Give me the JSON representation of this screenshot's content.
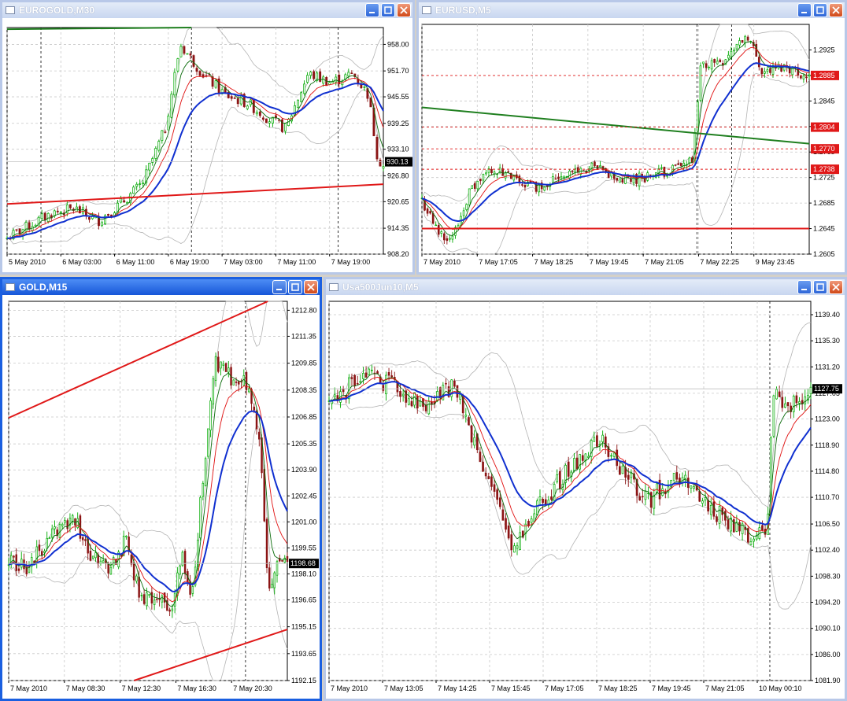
{
  "colors": {
    "grid": "#c8c8c8",
    "bull": "#00aa00",
    "bear": "#8b1414",
    "candle_body_bull": "#ffffff",
    "ma_fast": "#0b6b0b",
    "ma_mid": "#e01010",
    "ma_slow": "#1030d0",
    "bands": "#b4b4b4",
    "trend_green": "#1f7f1f",
    "trend_red": "#e01818",
    "level_red": "#e01818",
    "price_tag_bg": "#000000"
  },
  "windows": [
    {
      "id": "eurogold",
      "title": "EUROGOLD,M30",
      "active": false,
      "icon": "chart-window-icon",
      "chart_data": {
        "type": "candlestick",
        "ylim": [
          908.2,
          962.0
        ],
        "y_ticks": [
          "958.00",
          "951.70",
          "945.55",
          "939.25",
          "933.10",
          "926.80",
          "920.65",
          "914.35",
          "908.20"
        ],
        "x_labels": [
          "5 May 2010",
          "6 May 03:00",
          "6 May 11:00",
          "6 May 19:00",
          "7 May 03:00",
          "7 May 11:00",
          "7 May 19:00"
        ],
        "price_tag": "930.13",
        "price_value": 930.13,
        "anchors": [
          [
            0,
            912
          ],
          [
            0.06,
            915
          ],
          [
            0.12,
            918
          ],
          [
            0.18,
            919
          ],
          [
            0.24,
            916
          ],
          [
            0.3,
            920
          ],
          [
            0.36,
            925
          ],
          [
            0.42,
            938
          ],
          [
            0.46,
            958
          ],
          [
            0.52,
            951
          ],
          [
            0.58,
            946
          ],
          [
            0.64,
            944
          ],
          [
            0.7,
            940
          ],
          [
            0.74,
            938
          ],
          [
            0.8,
            951
          ],
          [
            0.86,
            949
          ],
          [
            0.92,
            951
          ],
          [
            0.96,
            946
          ],
          [
            0.985,
            931
          ],
          [
            1,
            929
          ]
        ],
        "gaps": [
          0.97
        ]
      }
    },
    {
      "id": "eurusd",
      "title": "EURUSD,M5",
      "active": false,
      "icon": "chart-window-icon",
      "chart_data": {
        "type": "candlestick",
        "ylim": [
          1.2605,
          1.2965
        ],
        "y_ticks": [
          "1.2925",
          "1.2885",
          "1.2845",
          "1.2805",
          "1.2765",
          "1.2725",
          "1.2685",
          "1.2645",
          "1.2605"
        ],
        "x_labels": [
          "7 May 2010",
          "7 May 17:05",
          "7 May 18:25",
          "7 May 19:45",
          "7 May 21:05",
          "7 May 22:25",
          "9 May 23:45"
        ],
        "levels": [
          {
            "label": "1.2885",
            "value": 1.2885
          },
          {
            "label": "1.2804",
            "value": 1.2804
          },
          {
            "label": "1.2770",
            "value": 1.277
          },
          {
            "label": "1.2738",
            "value": 1.2738
          }
        ],
        "anchors": [
          [
            0,
            1.269
          ],
          [
            0.04,
            1.264
          ],
          [
            0.08,
            1.263
          ],
          [
            0.12,
            1.27
          ],
          [
            0.18,
            1.274
          ],
          [
            0.24,
            1.272
          ],
          [
            0.3,
            1.271
          ],
          [
            0.36,
            1.273
          ],
          [
            0.44,
            1.274
          ],
          [
            0.52,
            1.272
          ],
          [
            0.6,
            1.273
          ],
          [
            0.66,
            1.274
          ],
          [
            0.7,
            1.275
          ],
          [
            0.72,
            1.29
          ],
          [
            0.78,
            1.291
          ],
          [
            0.84,
            1.295
          ],
          [
            0.88,
            1.289
          ],
          [
            0.94,
            1.29
          ],
          [
            1,
            1.288
          ]
        ],
        "gaps": [
          0.71
        ]
      }
    },
    {
      "id": "gold",
      "title": "GOLD,M15",
      "active": true,
      "icon": "chart-window-icon",
      "chart_data": {
        "type": "candlestick",
        "ylim": [
          1192.15,
          1213.3
        ],
        "y_ticks": [
          "1212.80",
          "1211.35",
          "1209.85",
          "1208.35",
          "1206.85",
          "1205.35",
          "1203.90",
          "1202.45",
          "1201.00",
          "1199.55",
          "1198.10",
          "1196.65",
          "1195.15",
          "1193.65",
          "1192.15"
        ],
        "x_labels": [
          "7 May 2010",
          "7 May 08:30",
          "7 May 12:30",
          "7 May 16:30",
          "7 May 20:30"
        ],
        "price_tag": "1198.68",
        "price_value": 1198.68,
        "anchors": [
          [
            0,
            1199
          ],
          [
            0.06,
            1198.5
          ],
          [
            0.12,
            1199.5
          ],
          [
            0.18,
            1200.5
          ],
          [
            0.24,
            1201
          ],
          [
            0.3,
            1199
          ],
          [
            0.36,
            1198.5
          ],
          [
            0.42,
            1200
          ],
          [
            0.48,
            1196.5
          ],
          [
            0.52,
            1197
          ],
          [
            0.58,
            1196
          ],
          [
            0.62,
            1199
          ],
          [
            0.66,
            1197
          ],
          [
            0.7,
            1204
          ],
          [
            0.74,
            1210
          ],
          [
            0.8,
            1209
          ],
          [
            0.86,
            1208.5
          ],
          [
            0.9,
            1206
          ],
          [
            0.93,
            1197
          ],
          [
            0.97,
            1199
          ],
          [
            1,
            1198.7
          ]
        ],
        "gaps": []
      }
    },
    {
      "id": "usa500",
      "title": "Usa500Jun10,M5",
      "active": false,
      "icon": "chart-window-icon",
      "chart_data": {
        "type": "candlestick",
        "ylim": [
          1081.9,
          1141.5
        ],
        "y_ticks": [
          "1139.40",
          "1135.30",
          "1131.20",
          "1127.05",
          "1123.00",
          "1118.90",
          "1114.80",
          "1110.70",
          "1106.50",
          "1102.40",
          "1098.30",
          "1094.20",
          "1090.10",
          "1086.00",
          "1081.90"
        ],
        "x_labels": [
          "7 May 2010",
          "7 May 13:05",
          "7 May 14:25",
          "7 May 15:45",
          "7 May 17:05",
          "7 May 18:25",
          "7 May 19:45",
          "7 May 21:05",
          "10 May 00:10"
        ],
        "price_tag": "1127.75",
        "price_value": 1127.75,
        "anchors": [
          [
            0,
            1126
          ],
          [
            0.08,
            1130
          ],
          [
            0.14,
            1128
          ],
          [
            0.2,
            1125
          ],
          [
            0.26,
            1128
          ],
          [
            0.32,
            1116
          ],
          [
            0.38,
            1103
          ],
          [
            0.44,
            1110
          ],
          [
            0.5,
            1115
          ],
          [
            0.56,
            1120
          ],
          [
            0.62,
            1114
          ],
          [
            0.66,
            1110
          ],
          [
            0.72,
            1114
          ],
          [
            0.78,
            1110
          ],
          [
            0.84,
            1106
          ],
          [
            0.88,
            1104
          ],
          [
            0.91,
            1105
          ],
          [
            0.92,
            1127
          ],
          [
            0.96,
            1125
          ],
          [
            1,
            1128
          ]
        ],
        "gaps": [
          0.915
        ]
      }
    }
  ]
}
